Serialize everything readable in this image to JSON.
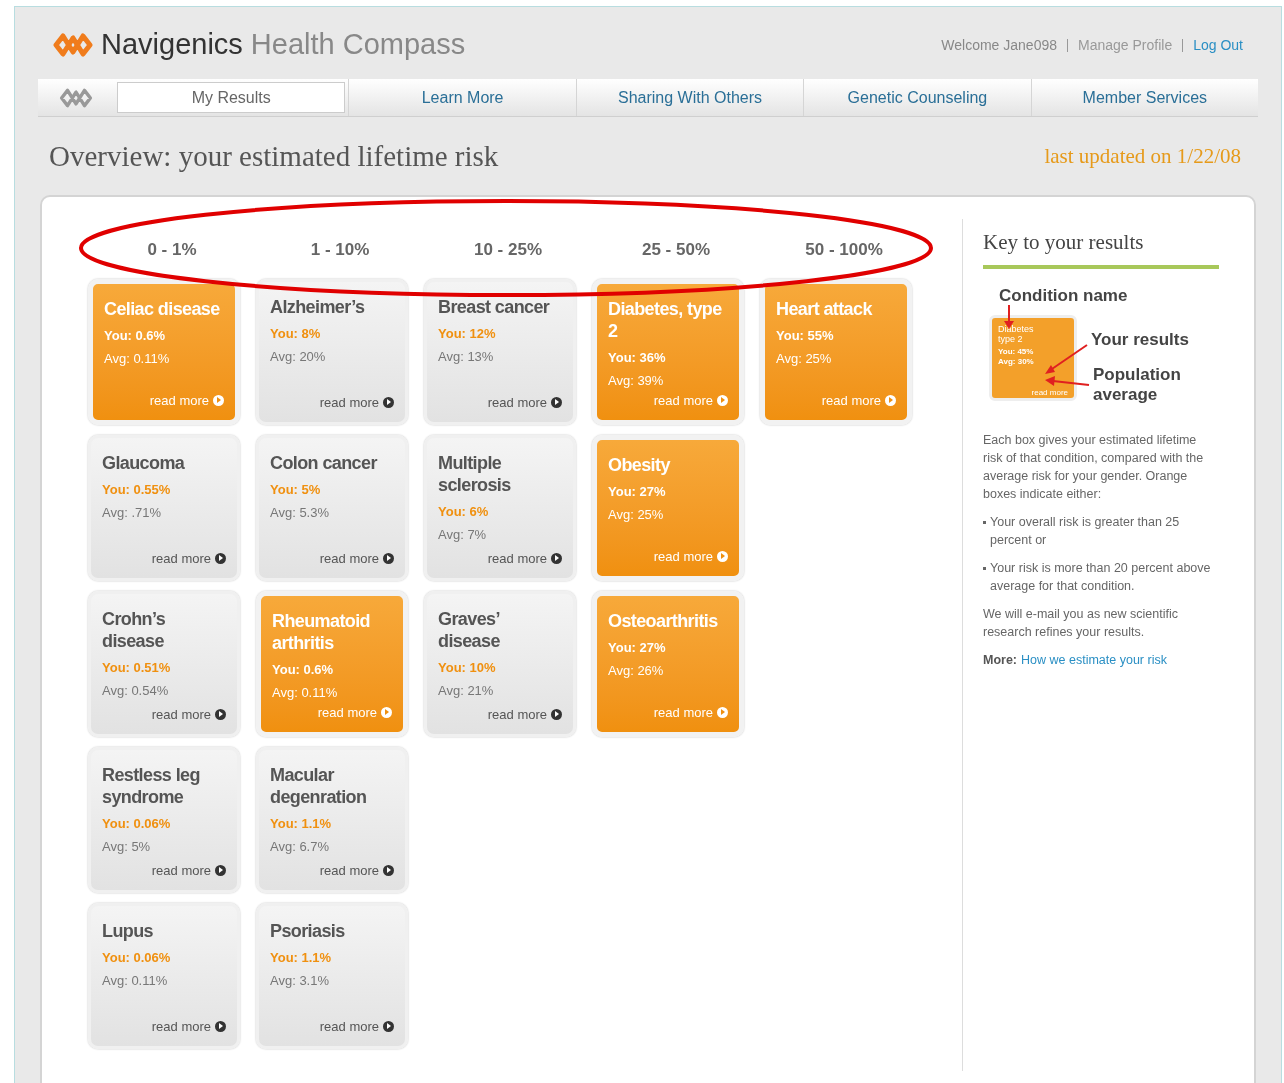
{
  "header": {
    "brand": "Navigenics",
    "product": "Health Compass",
    "welcome": "Welcome Jane098",
    "links": [
      {
        "label": "Manage Profile",
        "kind": "plain"
      },
      {
        "label": "Log Out",
        "kind": "link"
      }
    ]
  },
  "nav": {
    "tabs": [
      {
        "label": "My Results",
        "selected": true
      },
      {
        "label": "Learn More",
        "selected": false
      },
      {
        "label": "Sharing With Others",
        "selected": false
      },
      {
        "label": "Genetic Counseling",
        "selected": false
      },
      {
        "label": "Member Services",
        "selected": false
      }
    ]
  },
  "page": {
    "title": "Overview: your estimated lifetime risk",
    "updated": "last updated on 1/22/08"
  },
  "risk_columns": [
    "0 - 1%",
    "1 - 10%",
    "10 - 25%",
    "25 - 50%",
    "50 - 100%"
  ],
  "rows": [
    [
      {
        "name": "Celiac disease",
        "you": "You: 0.6%",
        "avg": "Avg: 0.11%",
        "link": "read more",
        "highlighted": true
      },
      {
        "name": "Alzheimer’s",
        "you": "You: 8%",
        "avg": "Avg: 20%",
        "link": "read more",
        "highlighted": false
      },
      {
        "name": "Breast cancer",
        "you": "You: 12%",
        "avg": "Avg: 13%",
        "link": "read more",
        "highlighted": false
      },
      {
        "name": "Diabetes, type 2",
        "you": "You: 36%",
        "avg": "Avg: 39%",
        "link": "read more",
        "highlighted": true
      },
      {
        "name": "Heart attack",
        "you": "You: 55%",
        "avg": "Avg: 25%",
        "link": "read more",
        "highlighted": true
      }
    ],
    [
      {
        "name": "Glaucoma",
        "you": "You: 0.55%",
        "avg": "Avg: .71%",
        "link": "read more",
        "highlighted": false
      },
      {
        "name": "Colon cancer",
        "you": "You: 5%",
        "avg": "Avg: 5.3%",
        "link": "read more",
        "highlighted": false
      },
      {
        "name": "Multiple sclerosis",
        "you": "You: 6%",
        "avg": "Avg: 7%",
        "link": "read more",
        "highlighted": false
      },
      {
        "name": "Obesity",
        "you": "You: 27%",
        "avg": "Avg: 25%",
        "link": "read more",
        "highlighted": true
      }
    ],
    [
      {
        "name": "Crohn’s disease",
        "you": "You: 0.51%",
        "avg": "Avg: 0.54%",
        "link": "read more",
        "highlighted": false
      },
      {
        "name": "Rheumatoid arthritis",
        "you": "You: 0.6%",
        "avg": "Avg: 0.11%",
        "link": "read more",
        "highlighted": true
      },
      {
        "name": "Graves’ disease",
        "you": "You: 10%",
        "avg": "Avg: 21%",
        "link": "read more",
        "highlighted": false
      },
      {
        "name": "Osteoarthritis",
        "you": "You: 27%",
        "avg": "Avg: 26%",
        "link": "read more",
        "highlighted": true
      }
    ],
    [
      {
        "name": "Restless leg syndrome",
        "you": "You: 0.06%",
        "avg": "Avg: 5%",
        "link": "read more",
        "highlighted": false
      },
      {
        "name": "Macular degenration",
        "you": "You: 1.1%",
        "avg": "Avg: 6.7%",
        "link": "read more",
        "highlighted": false
      }
    ],
    [
      {
        "name": "Lupus",
        "you": "You: 0.06%",
        "avg": "Avg: 0.11%",
        "link": "read more",
        "highlighted": false
      },
      {
        "name": "Psoriasis",
        "you": "You: 1.1%",
        "avg": "Avg: 3.1%",
        "link": "read more",
        "highlighted": false
      }
    ]
  ],
  "key": {
    "title": "Key to your results",
    "condition_label": "Condition name",
    "results_label": "Your results",
    "average_label": "Population average",
    "sample": {
      "name": "Diabetes type 2",
      "you": "You: 45%",
      "avg": "Avg: 30%",
      "link": "read more"
    },
    "intro": "Each box gives your estimated lifetime risk of that condition, compared with the average risk for your gender. Orange boxes indicate either:",
    "bullets": [
      "Your overall risk is greater than 25 percent or",
      "Your risk is more than 20 percent above average for that condition."
    ],
    "note": "We will e-mail you as new scientific research refines your results.",
    "more_label": "More:",
    "more_link": "How we estimate your risk"
  }
}
